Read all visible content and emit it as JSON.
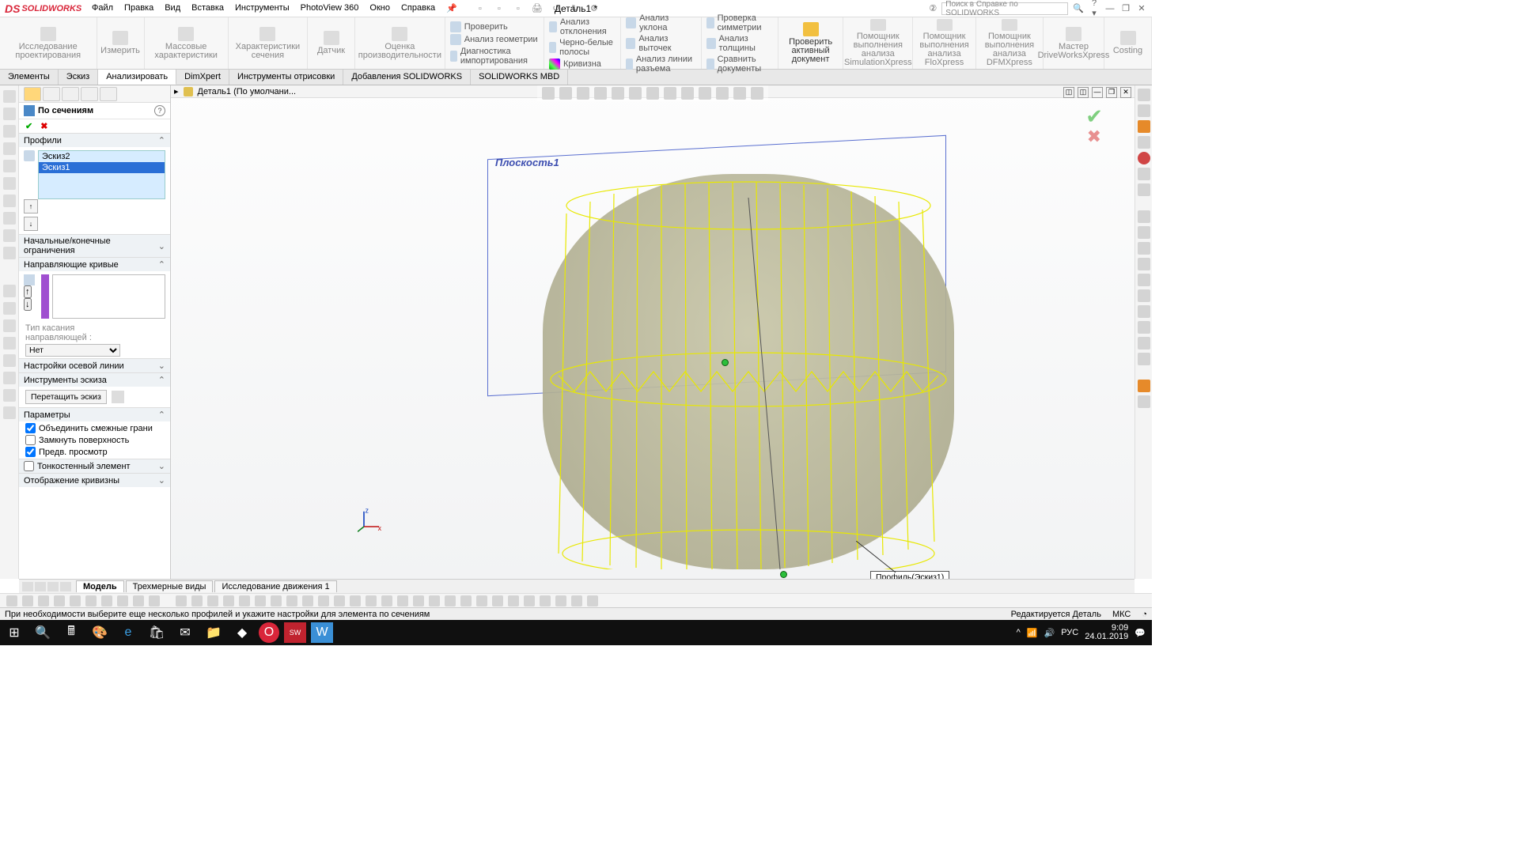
{
  "app": {
    "logo_prefix": "DS",
    "logo_text": "SOLIDWORKS"
  },
  "menu": [
    "Файл",
    "Правка",
    "Вид",
    "Вставка",
    "Инструменты",
    "PhotoView 360",
    "Окно",
    "Справка"
  ],
  "doc_title": "Деталь1 *",
  "search_placeholder": "Поиск в Справке по SOLIDWORKS",
  "ribbon_primary": [
    "Исследование\nпроектирования",
    "Измерить",
    "Массовые\nхарактеристики",
    "Характеристики\nсечения",
    "Датчик",
    "Оценка\nпроизводительности"
  ],
  "ribbon_col1": [
    "Проверить",
    "Анализ геометрии",
    "Диагностика импортирования"
  ],
  "ribbon_col2": [
    "Анализ отклонения",
    "Черно-белые полосы",
    "Кривизна"
  ],
  "ribbon_col3": [
    "Анализ уклона",
    "Анализ выточек",
    "Анализ линии разъема"
  ],
  "ribbon_col4": [
    "Проверка симметрии",
    "Анализ толщины",
    "Сравнить документы"
  ],
  "ribbon_big": "Проверить\nактивный документ",
  "ribbon_tail": [
    "Помощник\nвыполнения анализа\nSimulationXpress",
    "Помощник\nвыполнения\nанализа FloXpress",
    "Помощник\nвыполнения\nанализа DFMXpress",
    "Мастер\nDriveWorksXpress",
    "Costing"
  ],
  "tabs": [
    "Элементы",
    "Эскиз",
    "Анализировать",
    "DimXpert",
    "Инструменты отрисовки",
    "Добавления SOLIDWORKS",
    "SOLIDWORKS MBD"
  ],
  "active_tab": 2,
  "tree_expand": "▸",
  "tree_doc": "Деталь1  (По умолчани...",
  "pm": {
    "title": "По сечениям",
    "sections": {
      "profiles": "Профили",
      "startend": "Начальные/конечные ограничения",
      "guides": "Направляющие кривые",
      "guide_type_label": "Тип касания\nнаправляющей :",
      "guide_type_value": "Нет",
      "centerline": "Настройки осевой линии",
      "sketchtools": "Инструменты эскиза",
      "drag_sketch": "Перетащить эскиз",
      "options": "Параметры",
      "opt1": "Объединить смежные грани",
      "opt2": "Замкнуть поверхность",
      "opt3": "Предв. просмотр",
      "thin": "Тонкостенный элемент",
      "curvature": "Отображение кривизны"
    },
    "profiles_items": [
      "Эскиз2",
      "Эскиз1"
    ],
    "profiles_selected": 1
  },
  "viewport": {
    "plane_label": "Плоскость1",
    "profile_callout": "Профиль(Эскиз1)"
  },
  "bottom_tabs": [
    "Модель",
    "Трехмерные виды",
    "Исследование движения 1"
  ],
  "status": {
    "hint": "При необходимости выберите еще несколько профилей и укажите настройки для элемента по сечениям",
    "mode": "Редактируется Деталь",
    "units": "МКС"
  },
  "taskbar": {
    "time": "9:09",
    "date": "24.01.2019",
    "lang": "РУС"
  }
}
